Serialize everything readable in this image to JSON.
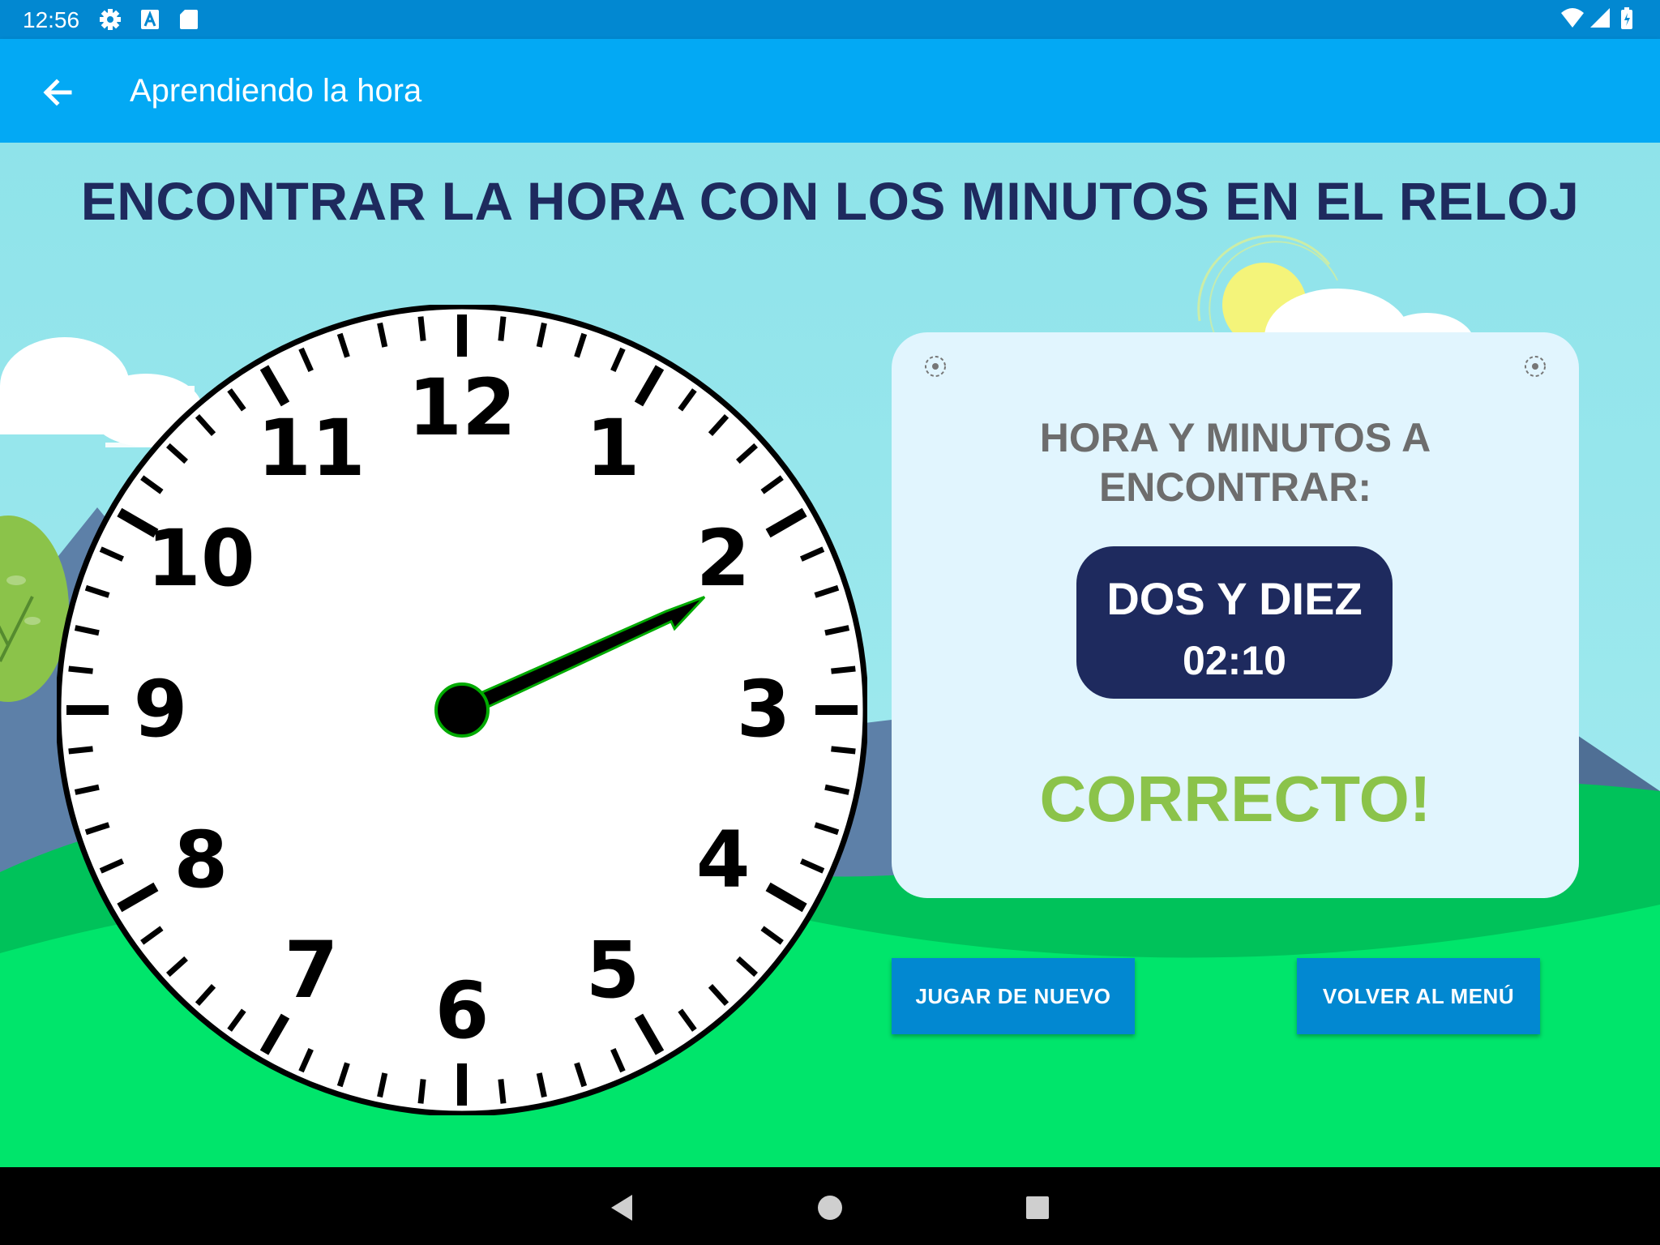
{
  "status_bar": {
    "time": "12:56",
    "left_icons": [
      "gear-icon",
      "a-box-icon",
      "sd-card-icon"
    ],
    "right_icons": [
      "wifi-icon",
      "signal-icon",
      "battery-icon"
    ]
  },
  "app_bar": {
    "back_icon": "arrow-left-icon",
    "title": "Aprendiendo la hora"
  },
  "heading": "ENCONTRAR LA HORA CON LOS MINUTOS EN EL RELOJ",
  "clock": {
    "numbers": [
      "12",
      "1",
      "2",
      "3",
      "4",
      "5",
      "6",
      "7",
      "8",
      "9",
      "10",
      "11"
    ],
    "hand_time": "02:10",
    "hand_color": "#000000",
    "hand_outline_color": "#00aa00"
  },
  "panel": {
    "label_line1": "HORA Y MINUTOS A",
    "label_line2": "ENCONTRAR:",
    "target_words": "DOS Y DIEZ",
    "target_digits": "02:10",
    "result": "CORRECTO!"
  },
  "buttons": {
    "replay": "JUGAR DE NUEVO",
    "menu": "VOLVER AL MENÚ"
  },
  "nav_bar": {
    "icons": [
      "back-triangle-icon",
      "home-circle-icon",
      "recents-square-icon"
    ]
  },
  "colors": {
    "status_bar": "#0288d1",
    "app_bar": "#03a9f4",
    "heading": "#1e2a5e",
    "target_box": "#1e2a5e",
    "correct": "#8bc34a",
    "button": "#0288d1"
  }
}
